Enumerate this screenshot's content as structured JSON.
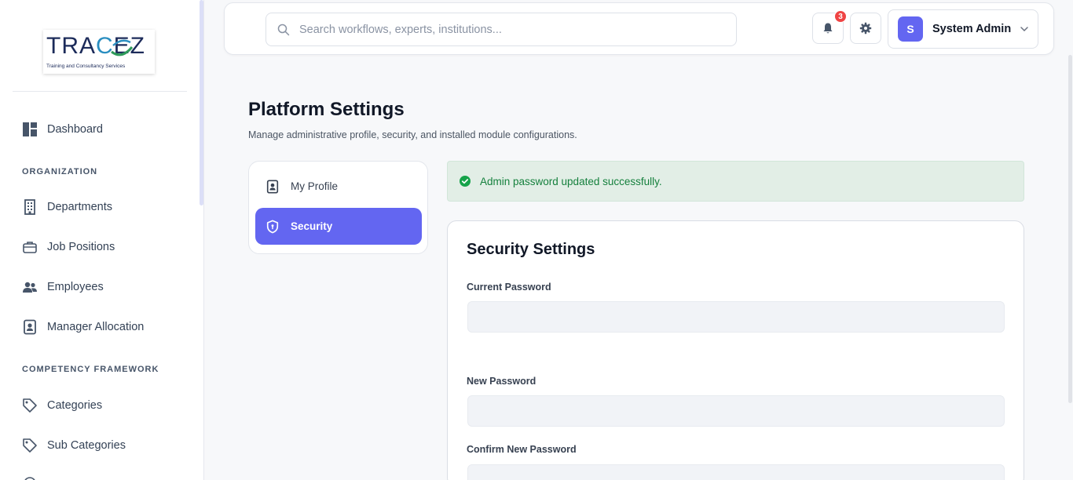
{
  "brand": {
    "logo_text_a": "TRA",
    "logo_text_c": "C",
    "logo_text_b": "EZ",
    "tagline": "Training and Consultancy Services"
  },
  "sidebar": {
    "items": [
      {
        "label": "Dashboard",
        "icon": "dashboard-icon"
      },
      {
        "label": "Departments",
        "icon": "building-icon"
      },
      {
        "label": "Job Positions",
        "icon": "briefcase-icon"
      },
      {
        "label": "Employees",
        "icon": "users-icon"
      },
      {
        "label": "Manager Allocation",
        "icon": "id-badge-icon"
      },
      {
        "label": "Categories",
        "icon": "tag-icon"
      },
      {
        "label": "Sub Categories",
        "icon": "tag-icon"
      }
    ],
    "sections": {
      "organization": "ORGANIZATION",
      "competency": "COMPETENCY FRAMEWORK"
    }
  },
  "header": {
    "search_placeholder": "Search workflows, experts, institutions...",
    "notifications_count": "3",
    "user_initial": "S",
    "user_name": "System Admin"
  },
  "page": {
    "title": "Platform Settings",
    "subtitle": "Manage administrative profile, security, and installed module configurations."
  },
  "tabs": {
    "profile": "My Profile",
    "security": "Security"
  },
  "alert": {
    "message": "Admin password updated successfully."
  },
  "security_form": {
    "title": "Security Settings",
    "current_password_label": "Current Password",
    "new_password_label": "New Password",
    "confirm_password_label": "Confirm New Password"
  },
  "colors": {
    "accent": "#6366f1",
    "success_bg": "#e2eee6",
    "success_text": "#15803d",
    "badge": "#ef4444"
  }
}
